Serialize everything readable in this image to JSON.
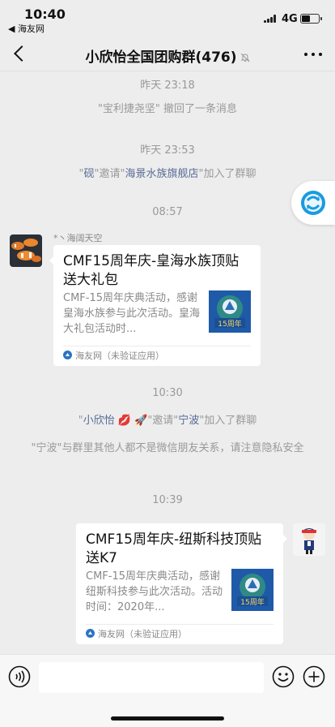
{
  "status_bar": {
    "time": "10:40",
    "back_app": "◀ 海友网",
    "network": "4G",
    "battery_level": 0.55
  },
  "nav": {
    "title": "小欣怡全国团购群(476)",
    "muted": true
  },
  "chat": {
    "timestamp_1": "昨天 23:18",
    "recall_text": "\"宝利捷尧坚\" 撤回了一条消息",
    "timestamp_2": "昨天 23:53",
    "join1": {
      "q1": "\"",
      "inviter": "砚",
      "mid": "\"邀请\"",
      "invitee": "海景水族旗舰店",
      "tail": "\"加入了群聊"
    },
    "timestamp_3": "08:57",
    "msg1": {
      "sender": "*丶海阔天空",
      "title": "CMF15周年庆-皇海水族顶贴送大礼包",
      "desc": "CMF-15周年庆典活动，感谢皇海水族参与此次活动。皇海大礼包活动时...",
      "source": "海友网（未验证应用）"
    },
    "timestamp_4": "10:30",
    "join2": {
      "q1": "\"",
      "inviter": "小欣怡 💋 🚀",
      "mid": "\"邀请\"",
      "invitee": "宁波",
      "tail": "\"加入了群聊"
    },
    "privacy_notice": "\"宁波\"与群里其他人都不是微信朋友关系，请注意隐私安全",
    "timestamp_5": "10:39",
    "msg2": {
      "title": "CMF15周年庆-纽斯科技顶贴送K7",
      "desc": "CMF-15周年庆典活动，感谢纽斯科技参与此次活动。活动时间：2020年...",
      "source": "海友网（未验证应用）"
    }
  },
  "input_bar": {
    "placeholder": ""
  },
  "colors": {
    "background": "#ededed",
    "link_name": "#576b95",
    "system_text": "#999999",
    "bubble": "#ffffff"
  }
}
